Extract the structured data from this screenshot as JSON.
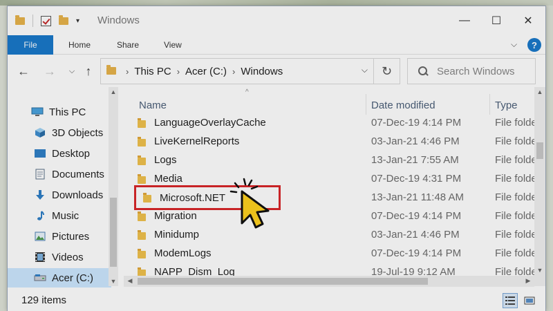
{
  "window": {
    "title": "Windows",
    "controls": {
      "minimize": "—",
      "maximize": "☐",
      "close": "✕"
    }
  },
  "ribbon": {
    "file_tab": "File",
    "tabs": [
      "Home",
      "Share",
      "View"
    ],
    "help": "?"
  },
  "address_bar": {
    "crumbs": [
      "This PC",
      "Acer (C:)",
      "Windows"
    ]
  },
  "search": {
    "placeholder": "Search Windows"
  },
  "nav_pane": {
    "items": [
      {
        "label": "This PC",
        "icon": "computer-icon",
        "selected": false
      },
      {
        "label": "3D Objects",
        "icon": "3d-objects-icon",
        "selected": false
      },
      {
        "label": "Desktop",
        "icon": "desktop-icon",
        "selected": false
      },
      {
        "label": "Documents",
        "icon": "documents-icon",
        "selected": false
      },
      {
        "label": "Downloads",
        "icon": "downloads-icon",
        "selected": false
      },
      {
        "label": "Music",
        "icon": "music-icon",
        "selected": false
      },
      {
        "label": "Pictures",
        "icon": "pictures-icon",
        "selected": false
      },
      {
        "label": "Videos",
        "icon": "videos-icon",
        "selected": false
      },
      {
        "label": "Acer (C:)",
        "icon": "drive-icon",
        "selected": true
      }
    ]
  },
  "file_list": {
    "columns": {
      "name": "Name",
      "date": "Date modified",
      "type": "Type"
    },
    "rows": [
      {
        "name": "LanguageOverlayCache",
        "date": "07-Dec-19 4:14 PM",
        "type": "File folder"
      },
      {
        "name": "LiveKernelReports",
        "date": "03-Jan-21 4:46 PM",
        "type": "File folder"
      },
      {
        "name": "Logs",
        "date": "13-Jan-21 7:55 AM",
        "type": "File folder"
      },
      {
        "name": "Media",
        "date": "07-Dec-19 4:31 PM",
        "type": "File folder"
      },
      {
        "name": "Microsoft.NET",
        "date": "13-Jan-21 11:48 AM",
        "type": "File folder",
        "highlighted": true
      },
      {
        "name": "Migration",
        "date": "07-Dec-19 4:14 PM",
        "type": "File folder"
      },
      {
        "name": "Minidump",
        "date": "03-Jan-21 4:46 PM",
        "type": "File folder"
      },
      {
        "name": "ModemLogs",
        "date": "07-Dec-19 4:14 PM",
        "type": "File folder"
      },
      {
        "name": "NAPP_Dism_Log",
        "date": "19-Jul-19 9:12 AM",
        "type": "File folder"
      }
    ]
  },
  "status_bar": {
    "item_count": "129 items"
  },
  "colors": {
    "accent": "#1979ca",
    "highlight_border": "#d9262a",
    "selected_bg": "#cce8ff",
    "cursor": "#ffd21f"
  }
}
